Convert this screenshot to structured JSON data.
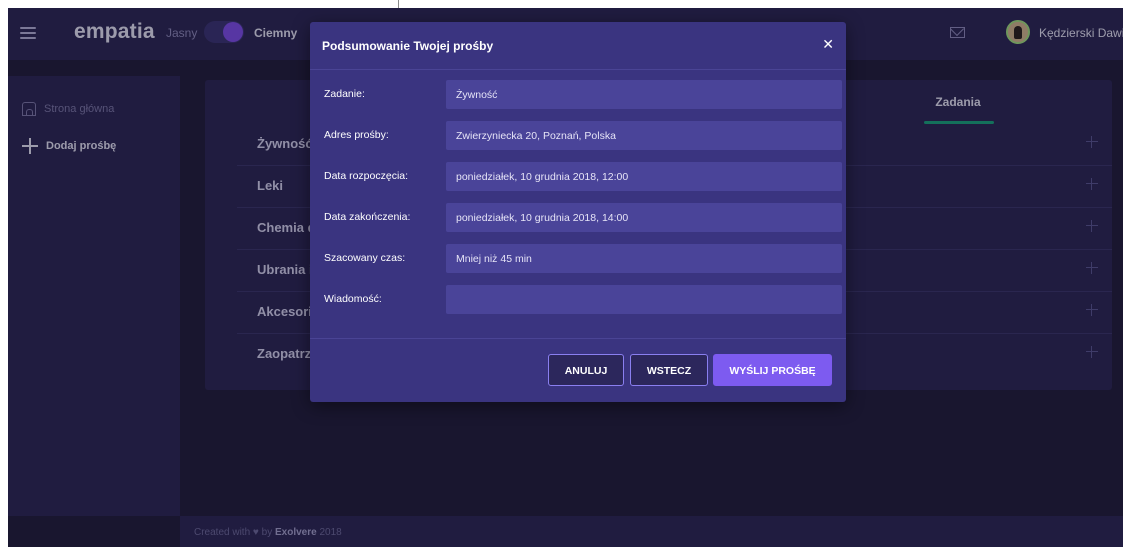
{
  "colors": {
    "background": "#1f1c36",
    "panel": "#2a2650",
    "modal": "#3a3480",
    "accent": "#7d5bf0",
    "tab_underline": "#18a77a"
  },
  "header": {
    "menu_icon": "hamburger-icon",
    "brand": "empatia",
    "theme_light_label": "Jasny",
    "theme_dark_label": "Ciemny",
    "mail_icon": "mail-icon",
    "user_name": "Kędzierski Dawid"
  },
  "sidebar": {
    "items": [
      {
        "icon": "home-icon",
        "label": "Strona główna"
      },
      {
        "icon": "plus-icon",
        "label": "Dodaj prośbę"
      }
    ]
  },
  "main": {
    "tabs": [
      {
        "label": "Zadania"
      }
    ],
    "categories": [
      {
        "label": "Żywność"
      },
      {
        "label": "Leki"
      },
      {
        "label": "Chemia d"
      },
      {
        "label": "Ubrania i"
      },
      {
        "label": "Akcesori"
      },
      {
        "label": "Zaopatrz"
      }
    ]
  },
  "modal": {
    "title": "Podsumowanie Twojej prośby",
    "close_icon": "close-icon",
    "fields": [
      {
        "label": "Zadanie:",
        "value": "Żywność"
      },
      {
        "label": "Adres prośby:",
        "value": "Zwierzyniecka 20, Poznań, Polska"
      },
      {
        "label": "Data rozpoczęcia:",
        "value": "poniedziałek, 10 grudnia 2018, 12:00"
      },
      {
        "label": "Data zakończenia:",
        "value": "poniedziałek, 10 grudnia 2018, 14:00"
      },
      {
        "label": "Szacowany czas:",
        "value": "Mniej niż 45 min"
      },
      {
        "label": "Wiadomość:",
        "value": ""
      }
    ],
    "buttons": {
      "cancel": "ANULUJ",
      "back": "WSTECZ",
      "send": "WYŚLIJ PROŚBĘ"
    }
  },
  "footer": {
    "prefix": "Created with ♥ by",
    "brand": "Exolvere",
    "year": "2018"
  }
}
